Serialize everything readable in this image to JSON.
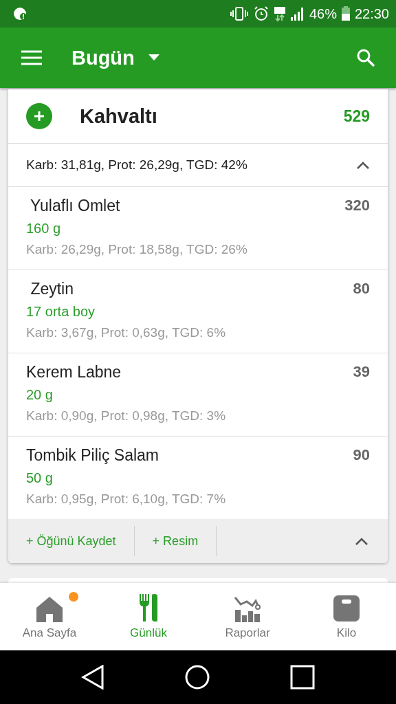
{
  "status_bar": {
    "battery": "46%",
    "time": "22:30"
  },
  "app_bar": {
    "title": "Bugün"
  },
  "meal": {
    "name": "Kahvaltı",
    "calories": "529",
    "summary": "Karb: 31,81g, Prot: 26,29g, TGD: 42%",
    "expanded": true,
    "items": [
      {
        "name": " Yulaflı Omlet",
        "amount": "160 g",
        "calories": "320",
        "macros": "Karb: 26,29g, Prot: 18,58g, TGD: 26%"
      },
      {
        "name": " Zeytin",
        "amount": "17 orta boy",
        "calories": "80",
        "macros": "Karb: 3,67g, Prot: 0,63g, TGD: 6%"
      },
      {
        "name": "Kerem Labne",
        "amount": "20 g",
        "calories": "39",
        "macros": "Karb: 0,90g, Prot: 0,98g, TGD: 3%"
      },
      {
        "name": "Tombik Piliç Salam",
        "amount": "50 g",
        "calories": "90",
        "macros": "Karb: 0,95g, Prot: 6,10g, TGD: 7%"
      }
    ],
    "actions": [
      "+ Öğünü Kaydet",
      "+ Resim"
    ]
  },
  "bottom_nav": [
    {
      "kind": "home",
      "label": "Ana Sayfa",
      "selected": false,
      "notification": true
    },
    {
      "kind": "diary",
      "label": "Günlük",
      "selected": true,
      "notification": false
    },
    {
      "kind": "reports",
      "label": "Raporlar",
      "selected": false,
      "notification": false
    },
    {
      "kind": "weight",
      "label": "Kilo",
      "selected": false,
      "notification": false
    }
  ]
}
